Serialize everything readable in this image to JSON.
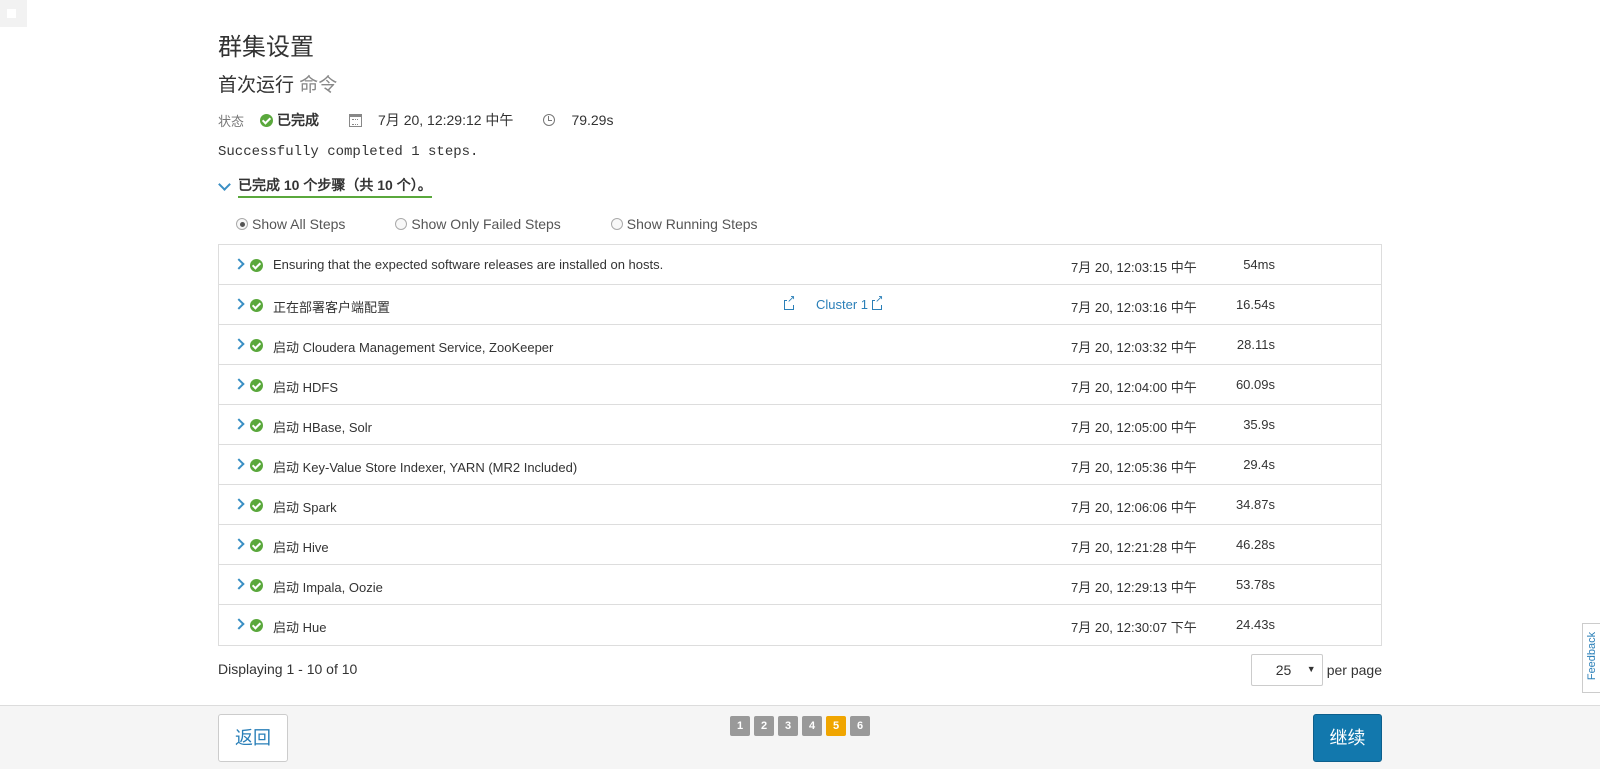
{
  "page": {
    "title": "群集设置",
    "subtitle_main": "首次运行",
    "subtitle_muted": "命令"
  },
  "status": {
    "label": "状态",
    "value": "已完成",
    "datetime": "7月 20, 12:29:12 中午",
    "duration": "79.29s"
  },
  "message": "Successfully completed 1 steps.",
  "summary": "已完成 10 个步骤（共 10 个）。",
  "filters": [
    {
      "label": "Show All Steps",
      "checked": true
    },
    {
      "label": "Show Only Failed Steps",
      "checked": false
    },
    {
      "label": "Show Running Steps",
      "checked": false
    }
  ],
  "steps": [
    {
      "name": "Ensuring that the expected software releases are installed on hosts.",
      "time": "7月 20, 12:03:15 中午",
      "duration": "54ms"
    },
    {
      "name": "正在部署客户端配置",
      "link": "Cluster 1",
      "time": "7月 20, 12:03:16 中午",
      "duration": "16.54s"
    },
    {
      "name": "启动 Cloudera Management Service, ZooKeeper",
      "time": "7月 20, 12:03:32 中午",
      "duration": "28.11s"
    },
    {
      "name": "启动 HDFS",
      "time": "7月 20, 12:04:00 中午",
      "duration": "60.09s"
    },
    {
      "name": "启动 HBase, Solr",
      "time": "7月 20, 12:05:00 中午",
      "duration": "35.9s"
    },
    {
      "name": "启动 Key-Value Store Indexer, YARN (MR2 Included)",
      "time": "7月 20, 12:05:36 中午",
      "duration": "29.4s"
    },
    {
      "name": "启动 Spark",
      "time": "7月 20, 12:06:06 中午",
      "duration": "34.87s"
    },
    {
      "name": "启动 Hive",
      "time": "7月 20, 12:21:28 中午",
      "duration": "46.28s"
    },
    {
      "name": "启动 Impala, Oozie",
      "time": "7月 20, 12:29:13 中午",
      "duration": "53.78s"
    },
    {
      "name": "启动 Hue",
      "time": "7月 20, 12:30:07 下午",
      "duration": "24.43s"
    }
  ],
  "pagination": {
    "displaying": "Displaying 1 - 10 of 10",
    "per_page_value": "25",
    "per_page_label": "per page"
  },
  "footer": {
    "back_label": "返回",
    "continue_label": "继续",
    "wizard_steps": [
      "1",
      "2",
      "3",
      "4",
      "5",
      "6"
    ],
    "active_step": "5"
  },
  "feedback_label": "Feedback",
  "colors": {
    "success": "#5aa83c",
    "link": "#2a7fb8",
    "primary_button": "#1278ad",
    "active_step": "#f0a500"
  },
  "icons": [
    "check-circle-icon",
    "calendar-icon",
    "clock-icon",
    "chevron-down-icon",
    "chevron-right-icon",
    "external-link-icon"
  ]
}
